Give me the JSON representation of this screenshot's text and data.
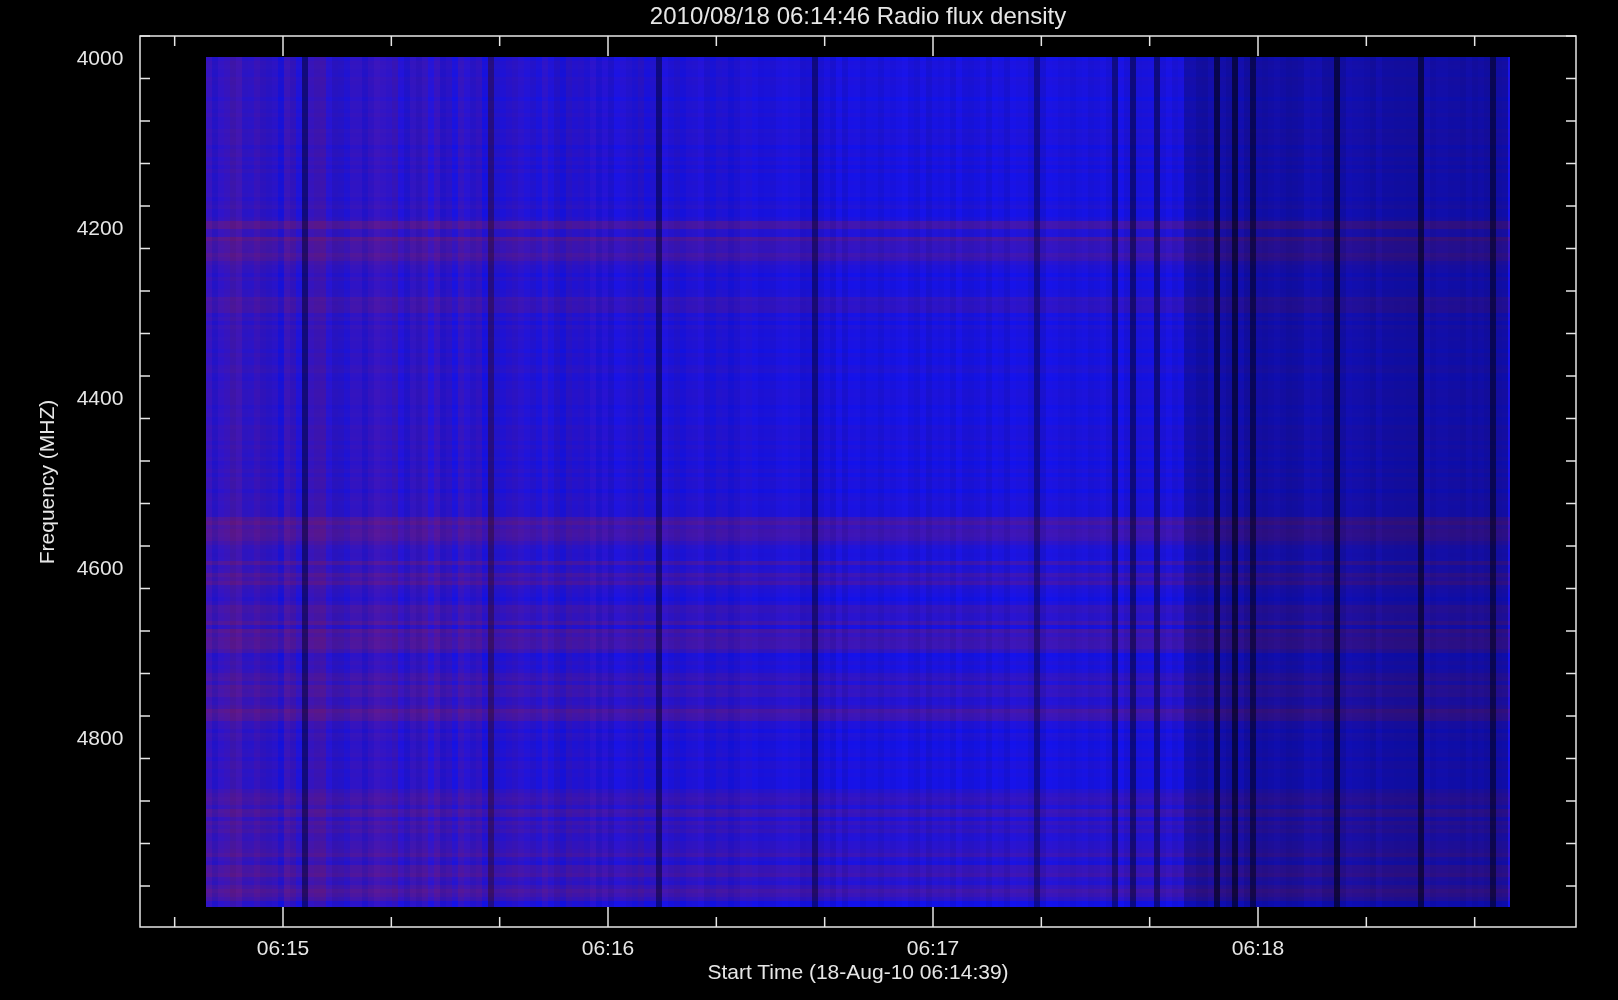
{
  "title": "2010/08/18 06:14:46 Radio flux density",
  "ylabel": "Frequency (MHZ)",
  "xlabel": "Start Time (18-Aug-10 06:14:39)",
  "yticks": [
    "4000",
    "4200",
    "4400",
    "4600",
    "4800"
  ],
  "xticks": [
    "06:15",
    "06:16",
    "06:17",
    "06:18"
  ]
}
